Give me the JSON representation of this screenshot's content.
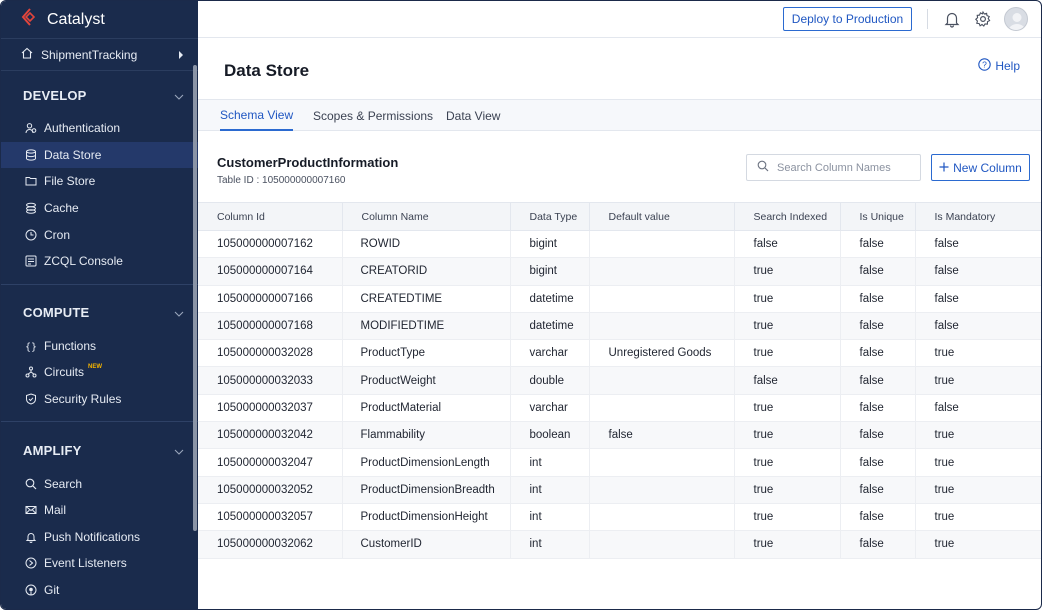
{
  "app": {
    "name": "Catalyst"
  },
  "project": {
    "name": "ShipmentTracking"
  },
  "sidebar": {
    "sections": [
      {
        "title": "DEVELOP",
        "items": [
          {
            "label": "Authentication",
            "icon": "users-icon"
          },
          {
            "label": "Data Store",
            "icon": "database-icon",
            "active": true
          },
          {
            "label": "File Store",
            "icon": "folder-icon"
          },
          {
            "label": "Cache",
            "icon": "cache-icon"
          },
          {
            "label": "Cron",
            "icon": "clock-icon"
          },
          {
            "label": "ZCQL Console",
            "icon": "console-icon"
          }
        ]
      },
      {
        "title": "COMPUTE",
        "items": [
          {
            "label": "Functions",
            "icon": "braces-icon"
          },
          {
            "label": "Circuits",
            "icon": "circuit-icon",
            "badge": "NEW"
          },
          {
            "label": "Security Rules",
            "icon": "shield-icon"
          }
        ]
      },
      {
        "title": "AMPLIFY",
        "items": [
          {
            "label": "Search",
            "icon": "search-icon"
          },
          {
            "label": "Mail",
            "icon": "mail-icon"
          },
          {
            "label": "Push Notifications",
            "icon": "bell-icon"
          },
          {
            "label": "Event Listeners",
            "icon": "event-icon"
          },
          {
            "label": "Git",
            "icon": "git-icon"
          }
        ]
      }
    ]
  },
  "topbar": {
    "deploy_label": "Deploy to Production"
  },
  "header": {
    "title": "Data Store",
    "help_label": "Help"
  },
  "tabs": [
    {
      "label": "Schema View",
      "active": true
    },
    {
      "label": "Scopes & Permissions"
    },
    {
      "label": "Data View"
    }
  ],
  "table_info": {
    "name": "CustomerProductInformation",
    "id_text": "Table ID : 105000000007160",
    "search_placeholder": "Search Column Names",
    "new_column_label": "New Column"
  },
  "columns": [
    "Column Id",
    "Column Name",
    "Data Type",
    "Default value",
    "Search Indexed",
    "Is Unique",
    "Is Mandatory"
  ],
  "rows": [
    [
      "105000000007162",
      "ROWID",
      "bigint",
      "",
      "false",
      "false",
      "false"
    ],
    [
      "105000000007164",
      "CREATORID",
      "bigint",
      "",
      "true",
      "false",
      "false"
    ],
    [
      "105000000007166",
      "CREATEDTIME",
      "datetime",
      "",
      "true",
      "false",
      "false"
    ],
    [
      "105000000007168",
      "MODIFIEDTIME",
      "datetime",
      "",
      "true",
      "false",
      "false"
    ],
    [
      "105000000032028",
      "ProductType",
      "varchar",
      "Unregistered Goods",
      "true",
      "false",
      "true"
    ],
    [
      "105000000032033",
      "ProductWeight",
      "double",
      "",
      "false",
      "false",
      "true"
    ],
    [
      "105000000032037",
      "ProductMaterial",
      "varchar",
      "",
      "true",
      "false",
      "false"
    ],
    [
      "105000000032042",
      "Flammability",
      "boolean",
      "false",
      "true",
      "false",
      "true"
    ],
    [
      "105000000032047",
      "ProductDimensionLength",
      "int",
      "",
      "true",
      "false",
      "true"
    ],
    [
      "105000000032052",
      "ProductDimensionBreadth",
      "int",
      "",
      "true",
      "false",
      "true"
    ],
    [
      "105000000032057",
      "ProductDimensionHeight",
      "int",
      "",
      "true",
      "false",
      "true"
    ],
    [
      "105000000032062",
      "CustomerID",
      "int",
      "",
      "true",
      "false",
      "true"
    ]
  ],
  "colors": {
    "sidebar_bg": "#1a2b4c",
    "accent": "#2b6ad0",
    "badge_new": "#f5b400"
  }
}
